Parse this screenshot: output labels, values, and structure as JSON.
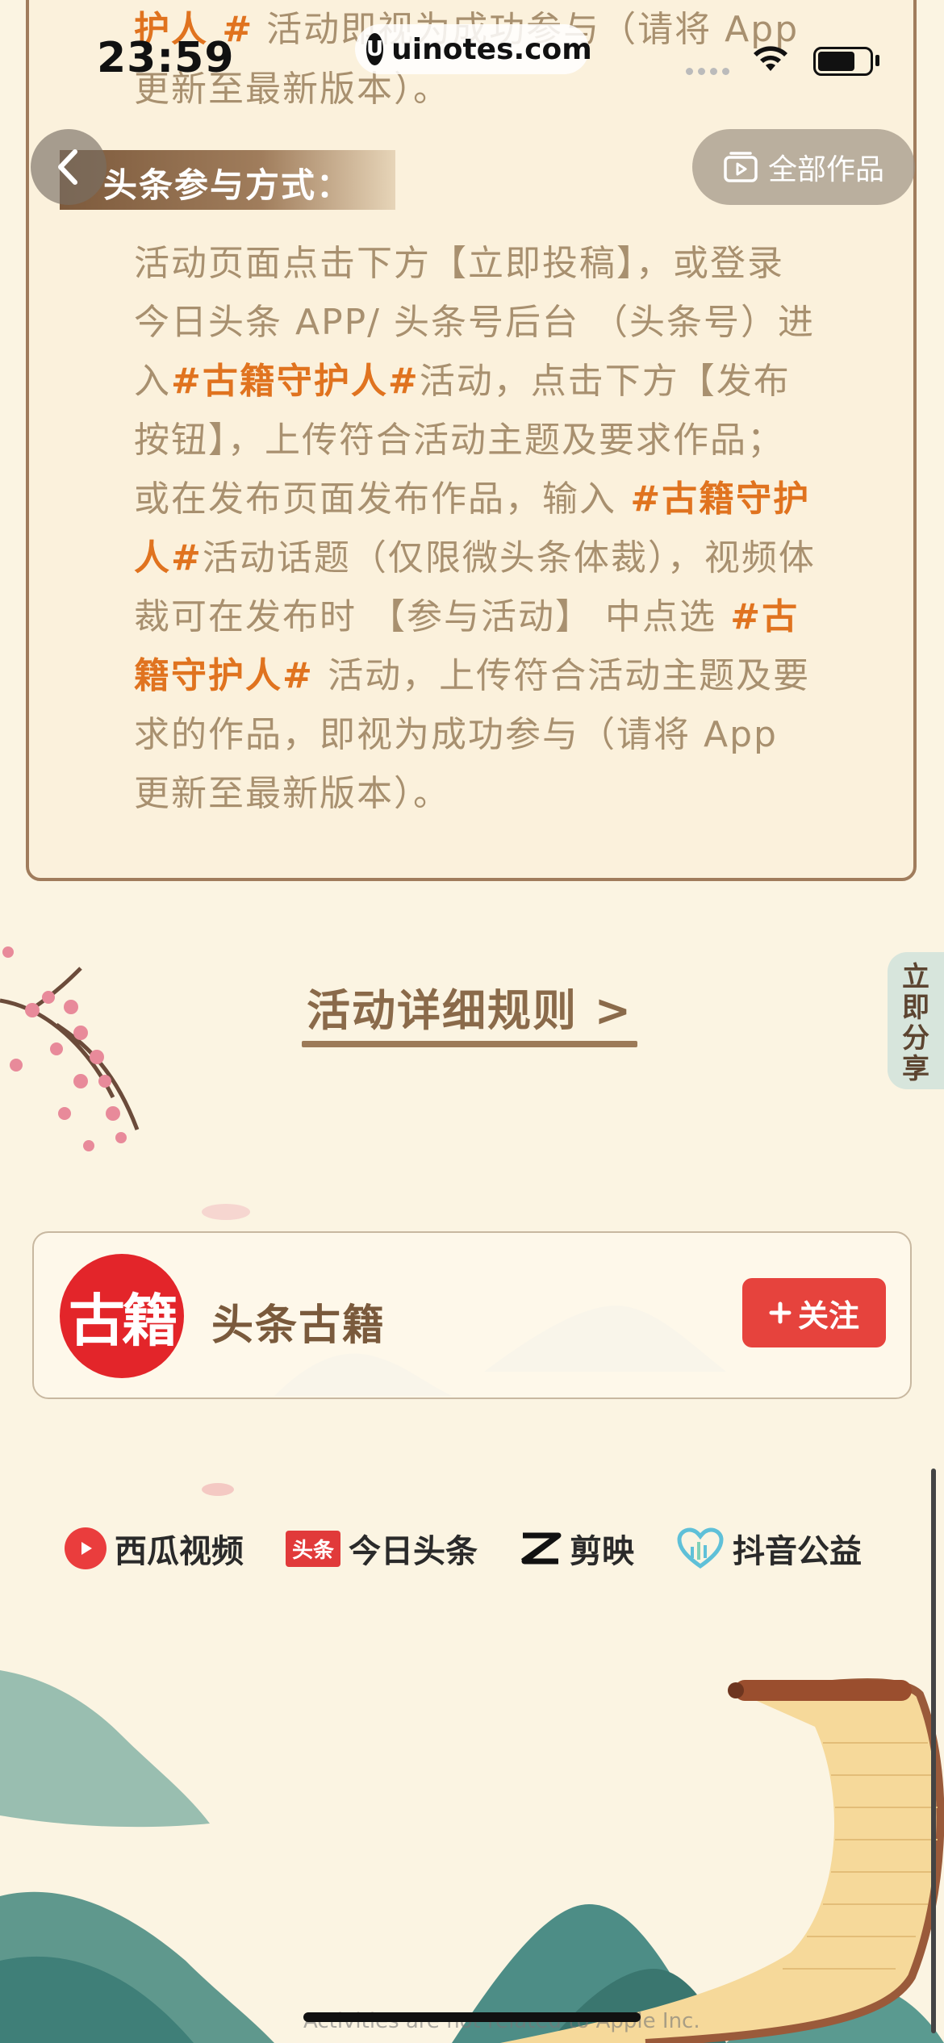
{
  "status_bar": {
    "time": "23:59",
    "site": "uinotes.com",
    "site_logo": "U"
  },
  "header": {
    "back_icon": "chevron-left-icon",
    "all_works_label": "全部作品"
  },
  "top_text": {
    "p1": "护人 #",
    "p2": " 活动即视为成功参与（请将 App 更新至最新版本）。"
  },
  "section": {
    "title": "头条参与方式："
  },
  "body": {
    "s1": "活动页面点击下方【立即投稿】，或登录今日头条 APP/ 头条号后台 （头条号）进入",
    "h1": "#古籍守护人#",
    "s2": "活动，点击下方【发布按钮】，上传符合活动主题及要求作品； 或在发布页面发布作品，输入",
    "h2": " #古籍守护人#",
    "s3": "活动话题（仅限微头条体裁），视频体裁可在发布时 【参与活动】 中点选",
    "h3": " #古籍守护人# ",
    "s4": "活动，上传符合活动主题及要求的作品，即视为成功参与（请将 App 更新至最新版本）。"
  },
  "rules_link": "活动详细规则 >",
  "share_tab": "立即分享",
  "account": {
    "avatar_text": "古籍",
    "name": "头条古籍",
    "follow_label": "关注",
    "follow_icon": "plus-icon"
  },
  "partners": [
    {
      "name": "西瓜视频",
      "icon": "xigua-play-icon"
    },
    {
      "name": "今日头条",
      "badge": "头条",
      "icon": "toutiao-badge"
    },
    {
      "name": "剪映",
      "icon": "jianying-icon"
    },
    {
      "name": "抖音公益",
      "icon": "heart-icon"
    }
  ],
  "footnote": "Activities are not related to Apple Inc."
}
